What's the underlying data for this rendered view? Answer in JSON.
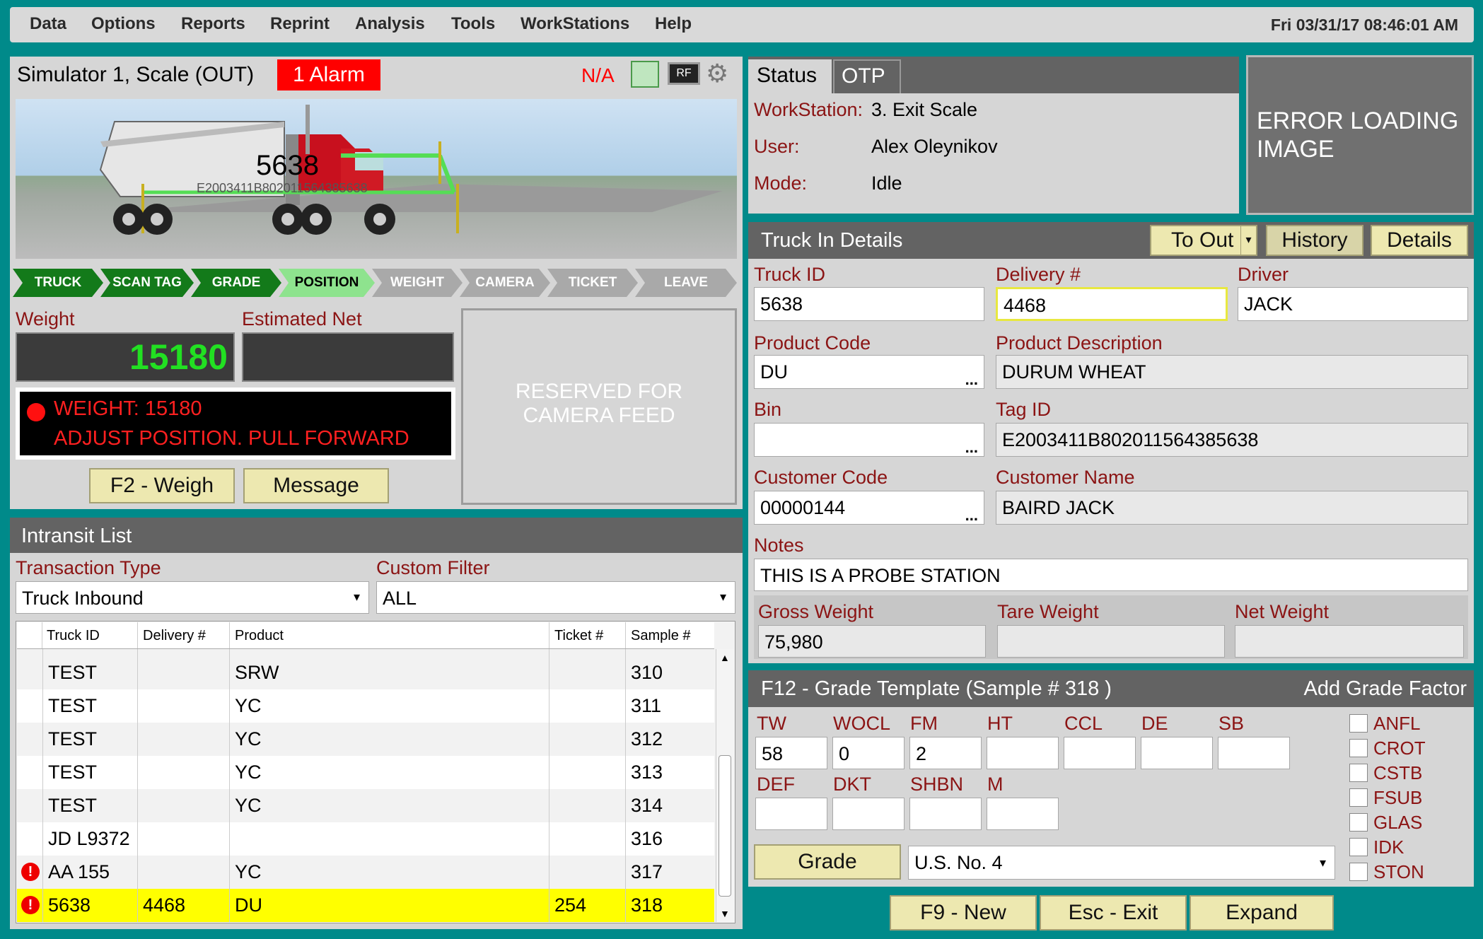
{
  "menubar": {
    "items": [
      "Data",
      "Options",
      "Reports",
      "Reprint",
      "Analysis",
      "Tools",
      "WorkStations",
      "Help"
    ],
    "datetime": "Fri 03/31/17 08:46:01 AM"
  },
  "scale_panel": {
    "title": "Simulator 1, Scale (OUT)",
    "alarm": "1 Alarm",
    "na": "N/A",
    "rf_label": "RF",
    "truck_number": "5638",
    "truck_tag": "E2003411B802011564385638",
    "steps": [
      "TRUCK",
      "SCAN TAG",
      "GRADE",
      "POSITION",
      "WEIGHT",
      "CAMERA",
      "TICKET",
      "LEAVE"
    ],
    "weight_label": "Weight",
    "weight_value": "15180",
    "est_net_label": "Estimated Net",
    "est_net_value": "",
    "message_line1": "WEIGHT: 15180",
    "message_line2": "ADJUST POSITION. PULL FORWARD",
    "camera_text": "RESERVED FOR CAMERA FEED",
    "weigh_button": "F2 - Weigh",
    "message_button": "Message"
  },
  "intransit": {
    "title": "Intransit List",
    "transaction_type_label": "Transaction Type",
    "transaction_type_value": "Truck Inbound",
    "custom_filter_label": "Custom Filter",
    "custom_filter_value": "ALL",
    "columns": [
      "Truck ID",
      "Delivery #",
      "Product",
      "Ticket #",
      "Sample #"
    ],
    "rows": [
      {
        "alert": false,
        "truck_id": "TEST",
        "delivery": "",
        "product": "SRW",
        "ticket": "",
        "sample": "310"
      },
      {
        "alert": false,
        "truck_id": "TEST",
        "delivery": "",
        "product": "YC",
        "ticket": "",
        "sample": "311"
      },
      {
        "alert": false,
        "truck_id": "TEST",
        "delivery": "",
        "product": "YC",
        "ticket": "",
        "sample": "312"
      },
      {
        "alert": false,
        "truck_id": "TEST",
        "delivery": "",
        "product": "YC",
        "ticket": "",
        "sample": "313"
      },
      {
        "alert": false,
        "truck_id": "TEST",
        "delivery": "",
        "product": "YC",
        "ticket": "",
        "sample": "314"
      },
      {
        "alert": false,
        "truck_id": "JD L9372",
        "delivery": "",
        "product": "",
        "ticket": "",
        "sample": "316"
      },
      {
        "alert": true,
        "truck_id": "AA 155",
        "delivery": "",
        "product": "YC",
        "ticket": "",
        "sample": "317"
      },
      {
        "alert": true,
        "truck_id": "5638",
        "delivery": "4468",
        "product": "DU",
        "ticket": "254",
        "sample": "318"
      }
    ],
    "alert_glyph": "!"
  },
  "status": {
    "tab_status": "Status",
    "tab_otp": "OTP",
    "workstation_label": "WorkStation:",
    "workstation_value": "3. Exit Scale",
    "user_label": "User:",
    "user_value": "Alex Oleynikov",
    "mode_label": "Mode:",
    "mode_value": "Idle",
    "image_error": "ERROR LOADING IMAGE"
  },
  "truck_details": {
    "title": "Truck In Details",
    "to_out_button": "To Out",
    "history_button": "History",
    "details_button": "Details",
    "truck_id_label": "Truck ID",
    "truck_id_value": "5638",
    "delivery_label": "Delivery #",
    "delivery_value": "4468",
    "driver_label": "Driver",
    "driver_value": "JACK",
    "product_code_label": "Product Code",
    "product_code_value": "DU",
    "product_desc_label": "Product Description",
    "product_desc_value": "DURUM WHEAT",
    "bin_label": "Bin",
    "bin_value": "",
    "tag_id_label": "Tag ID",
    "tag_id_value": "E2003411B802011564385638",
    "customer_code_label": "Customer Code",
    "customer_code_value": "00000144",
    "customer_name_label": "Customer Name",
    "customer_name_value": "BAIRD JACK",
    "notes_label": "Notes",
    "notes_value": "THIS IS A PROBE STATION",
    "gross_label": "Gross Weight",
    "gross_value": "75,980",
    "tare_label": "Tare Weight",
    "tare_value": "",
    "net_label": "Net Weight",
    "net_value": "",
    "lookup_dots": "..."
  },
  "grade": {
    "title": "F12 - Grade Template (Sample # 318 )",
    "add_factor": "Add Grade Factor",
    "factors_row1": [
      {
        "label": "TW",
        "value": "58"
      },
      {
        "label": "WOCL",
        "value": "0"
      },
      {
        "label": "FM",
        "value": "2"
      },
      {
        "label": "HT",
        "value": ""
      },
      {
        "label": "CCL",
        "value": ""
      },
      {
        "label": "DE",
        "value": ""
      },
      {
        "label": "SB",
        "value": ""
      }
    ],
    "factors_row2": [
      {
        "label": "DEF",
        "value": ""
      },
      {
        "label": "DKT",
        "value": ""
      },
      {
        "label": "SHBN",
        "value": ""
      },
      {
        "label": "M",
        "value": ""
      }
    ],
    "checkboxes": [
      "ANFL",
      "CROT",
      "CSTB",
      "FSUB",
      "GLAS",
      "IDK",
      "STON"
    ],
    "grade_button": "Grade",
    "grade_value": "U.S. No. 4"
  },
  "footer": {
    "new_button": "F9 - New",
    "exit_button": "Esc - Exit",
    "expand_button": "Expand"
  },
  "colors": {
    "background": "#008a8a",
    "header": "#636363",
    "label_red": "#8b1414",
    "button": "#ede8b0",
    "step_done": "#137a1a",
    "step_active": "#8ee38e",
    "step_pending": "#a9a9a9",
    "highlight_row": "#ffff00",
    "weight_green": "#22e022",
    "alarm_red": "#ff0000"
  }
}
